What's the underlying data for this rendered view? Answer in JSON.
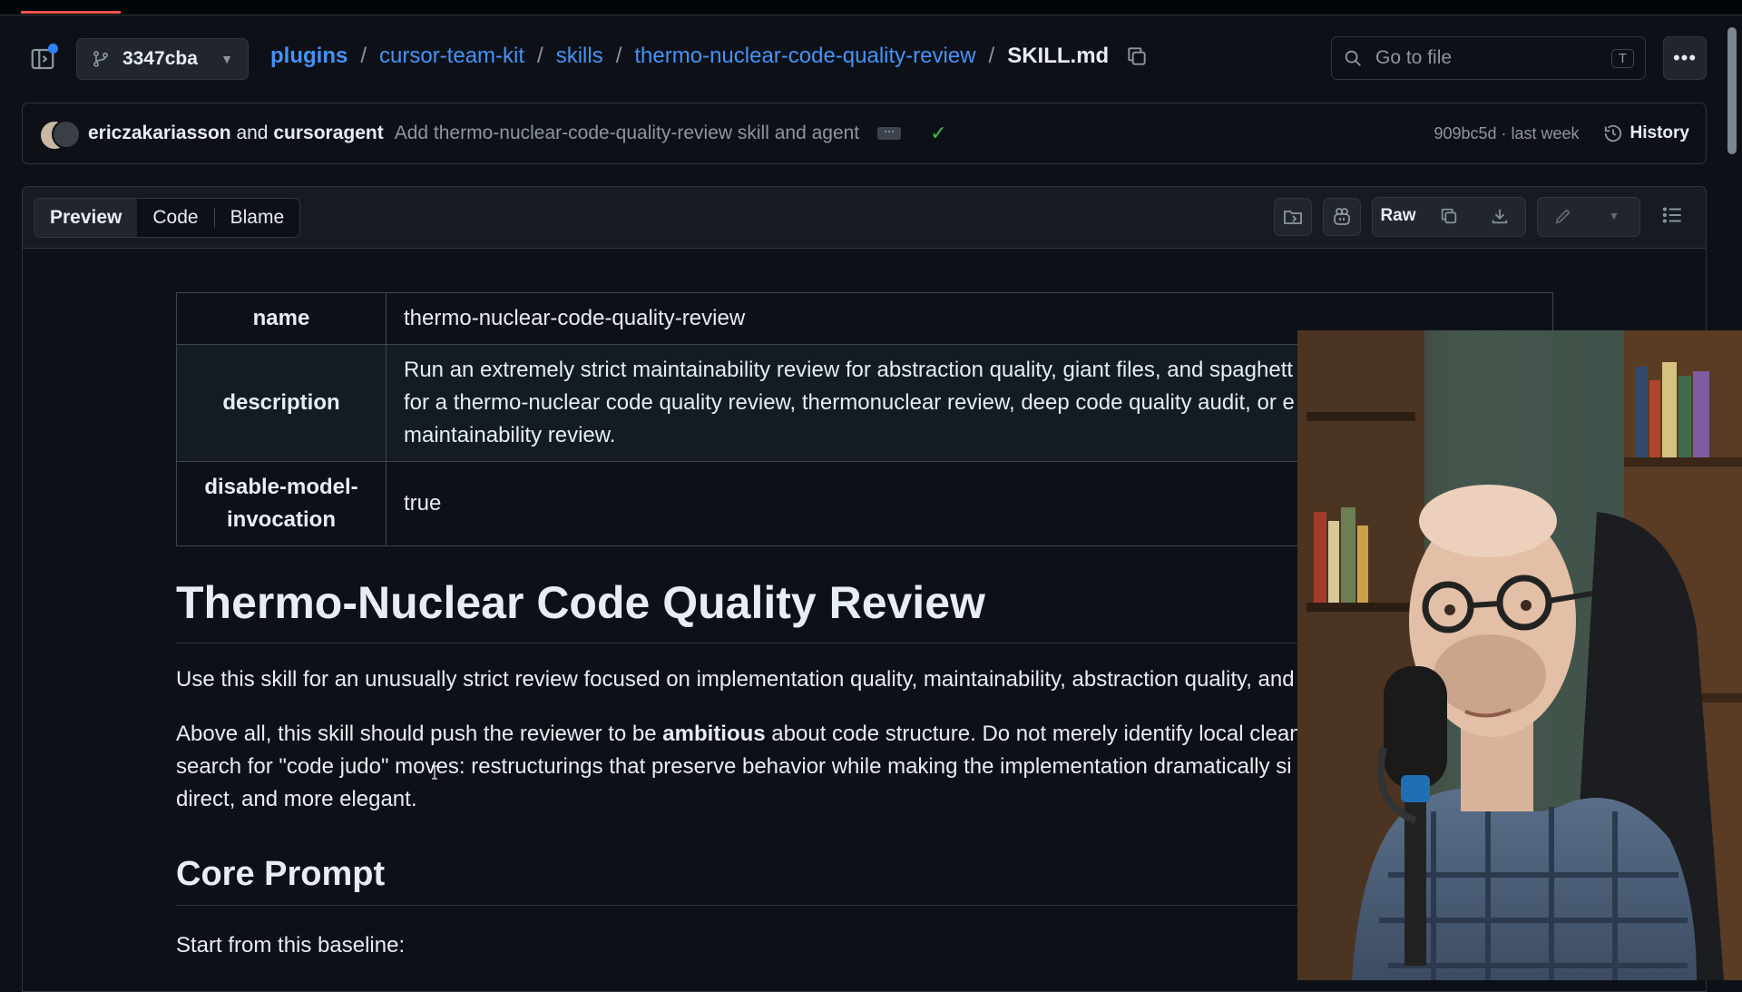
{
  "branch": {
    "name": "3347cba"
  },
  "breadcrumb": {
    "repo": "plugins",
    "parts": [
      "cursor-team-kit",
      "skills",
      "thermo-nuclear-code-quality-review"
    ],
    "separator": "/",
    "file": "SKILL.md"
  },
  "search": {
    "placeholder": "Go to file",
    "shortcut": "T"
  },
  "commit": {
    "author1": "ericzakariasson",
    "and_word": "and",
    "author2": "cursoragent",
    "message": "Add thermo-nuclear-code-quality-review skill and agent",
    "meta": "909bc5d · last week",
    "history_label": "History"
  },
  "view_tabs": {
    "preview": "Preview",
    "code": "Code",
    "blame": "Blame"
  },
  "toolbar": {
    "raw_label": "Raw"
  },
  "frontmatter": {
    "rows": [
      {
        "key": "name",
        "value": "thermo-nuclear-code-quality-review"
      },
      {
        "key": "description",
        "value": "Run an extremely strict maintainability review for abstraction quality, giant files, and spaghett",
        "value2": "for a thermo-nuclear code quality review, thermonuclear review, deep code quality audit, or e",
        "value3": "maintainability review."
      },
      {
        "key1": "disable-model-",
        "key2": "invocation",
        "value": "true"
      }
    ]
  },
  "markdown": {
    "h1": "Thermo-Nuclear Code Quality Review",
    "p1": "Use this skill for an unusually strict review focused on implementation quality, maintainability, abstraction quality, and",
    "p2_before": "Above all, this skill should push the reviewer to be ",
    "p2_bold": "ambitious",
    "p2_after": " about code structure. Do not merely identify local clean",
    "p2_line2": "search for \"code judo\" moves: restructurings that preserve behavior while making the implementation dramatically si",
    "p2_line3": "direct, and more elegant.",
    "h2": "Core Prompt",
    "p3": "Start from this baseline:"
  },
  "colors": {
    "link": "#4493f8",
    "success": "#3fb950",
    "background": "#0d1117",
    "border": "#30363d"
  }
}
